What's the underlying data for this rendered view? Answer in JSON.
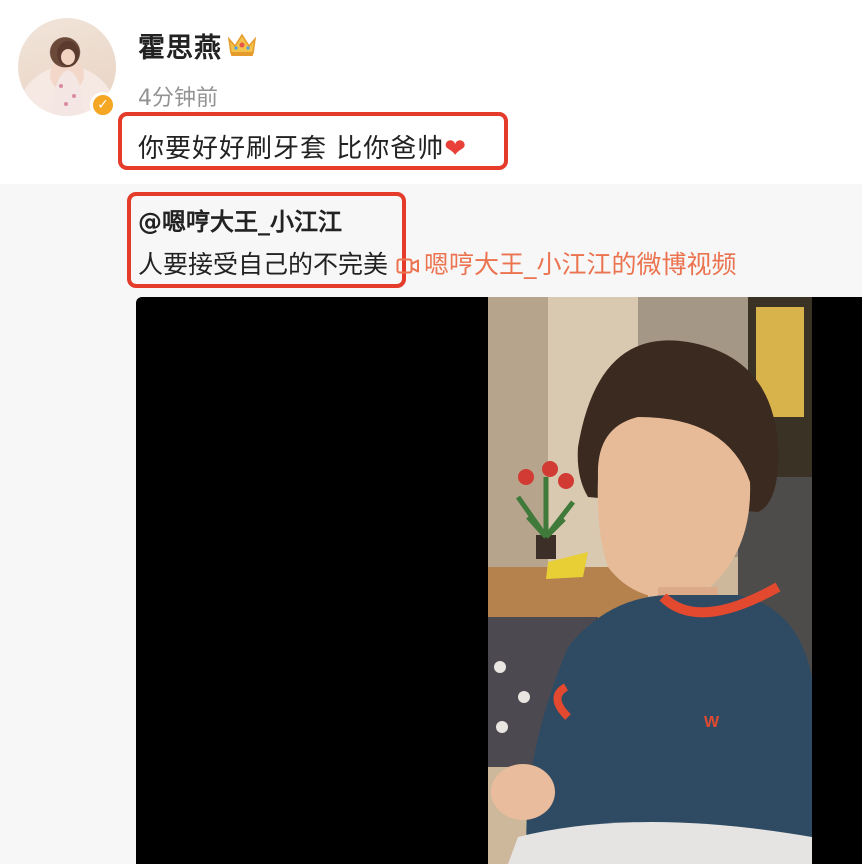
{
  "post": {
    "author": "霍思燕",
    "time": "4分钟前",
    "content": "你要好好刷牙套 比你爸帅",
    "heart": "❤"
  },
  "repost": {
    "author": "@嗯哼大王_小江江",
    "text": "人要接受自己的不完美",
    "video_link": "嗯哼大王_小江江的微博视频"
  },
  "colors": {
    "highlight_box": "#e43b2b",
    "link": "#eb7350",
    "verified_badge": "#f5a623",
    "repost_bg": "#f7f7f7"
  },
  "icons": [
    "verified-icon",
    "crown-icon",
    "video-camera-icon"
  ]
}
